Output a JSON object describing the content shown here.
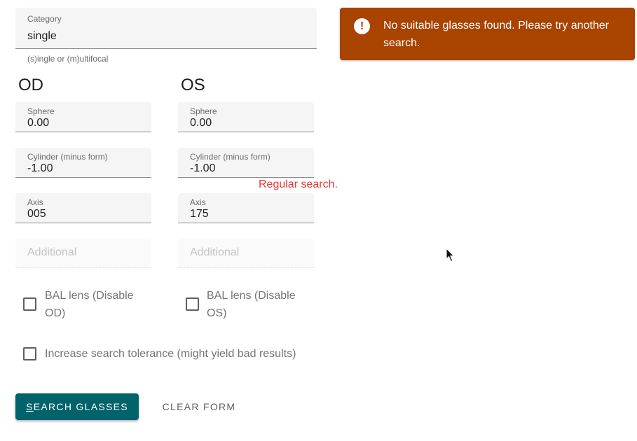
{
  "form": {
    "category": {
      "label": "Category",
      "value": "single",
      "helper": "(s)ingle or (m)ultifocal"
    },
    "od": {
      "heading": "OD",
      "sphere_label": "Sphere",
      "sphere_value": "0.00",
      "cylinder_label": "Cylinder (minus form)",
      "cylinder_value": "-1.00",
      "axis_label": "Axis",
      "axis_value": "005",
      "additional_placeholder": "Additional",
      "bal_label": "BAL lens (Disable OD)"
    },
    "os": {
      "heading": "OS",
      "sphere_label": "Sphere",
      "sphere_value": "0.00",
      "cylinder_label": "Cylinder (minus form)",
      "cylinder_value": "-1.00",
      "axis_label": "Axis",
      "axis_value": "175",
      "additional_placeholder": "Additional",
      "bal_label": "BAL lens (Disable OS)"
    },
    "search_mode_note": "Regular search.",
    "tolerance_label": "Increase search tolerance (might yield bad results)",
    "search_button_first": "S",
    "search_button_rest": "EARCH GLASSES",
    "clear_button": "CLEAR FORM"
  },
  "alert": {
    "icon": "exclamation-icon",
    "message": "No suitable glasses found. Please try another search."
  },
  "colors": {
    "primary": "#00626b",
    "alert_bg": "#a84300",
    "note_text": "#e53935"
  }
}
